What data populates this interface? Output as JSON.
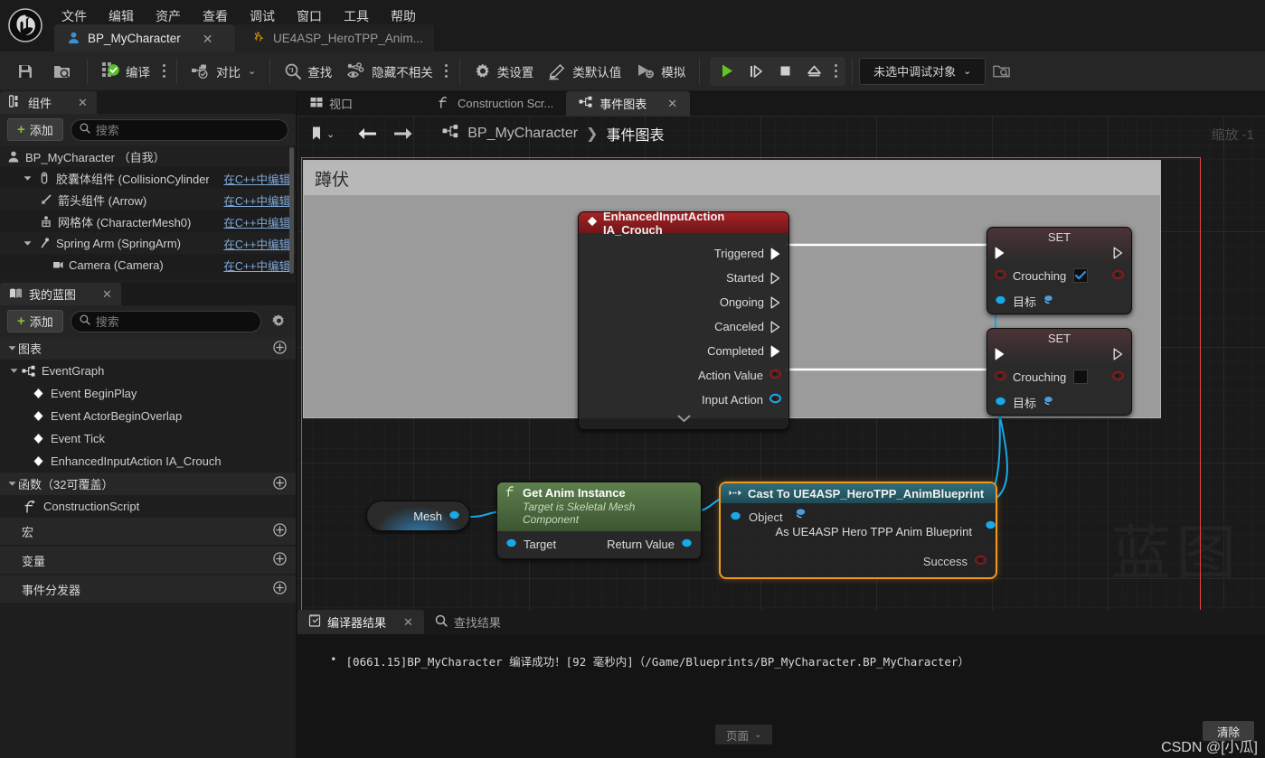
{
  "app": {
    "logo": "unreal-engine-logo",
    "menu": [
      "文件",
      "编辑",
      "资产",
      "查看",
      "调试",
      "窗口",
      "工具",
      "帮助"
    ]
  },
  "asset_tabs": [
    {
      "label": "BP_MyCharacter",
      "icon": "character-icon",
      "active": true,
      "closable": true
    },
    {
      "label": "UE4ASP_HeroTPP_Anim...",
      "icon": "anim-blueprint-icon",
      "active": false,
      "closable": false
    }
  ],
  "toolbar": {
    "save_label": "",
    "items": [
      {
        "name": "save",
        "label": ""
      },
      {
        "name": "browse",
        "label": ""
      },
      {
        "name": "compile",
        "label": "编译"
      },
      {
        "name": "diff",
        "label": "对比"
      },
      {
        "name": "find",
        "label": "查找"
      },
      {
        "name": "hide-unrelated",
        "label": "隐藏不相关"
      },
      {
        "name": "class-settings",
        "label": "类设置"
      },
      {
        "name": "class-defaults",
        "label": "类默认值"
      },
      {
        "name": "simulate",
        "label": "模拟"
      }
    ],
    "compile_label": "编译",
    "diff_label": "对比",
    "find_label": "查找",
    "hide_unrelated_label": "隐藏不相关",
    "class_settings_label": "类设置",
    "class_defaults_label": "类默认值",
    "simulate_label": "模拟",
    "debug_object": "未选中调试对象"
  },
  "components_panel": {
    "tab_label": "组件",
    "add_label": "添加",
    "search_placeholder": "搜索",
    "tree": [
      {
        "label": "BP_MyCharacter （自我）",
        "icon": "character-icon",
        "indent": 0,
        "expander": "none",
        "cpp": ""
      },
      {
        "label": "胶囊体组件 (CollisionCylinder)",
        "icon": "capsule-icon",
        "indent": 1,
        "expander": "down",
        "cpp": "在C++中编辑"
      },
      {
        "label": "箭头组件 (Arrow)",
        "icon": "arrow-icon",
        "indent": 2,
        "expander": "none",
        "cpp": "在C++中编辑"
      },
      {
        "label": "网格体 (CharacterMesh0)",
        "icon": "mesh-icon",
        "indent": 2,
        "expander": "none",
        "cpp": "在C++中编辑"
      },
      {
        "label": "Spring Arm (SpringArm)",
        "icon": "springarm-icon",
        "indent": 1,
        "expander": "down",
        "cpp": "在C++中编辑"
      },
      {
        "label": "Camera (Camera)",
        "icon": "camera-icon",
        "indent": 2,
        "expander": "none",
        "cpp": "在C++中编辑"
      }
    ]
  },
  "myblueprint_panel": {
    "tab_label": "我的蓝图",
    "add_label": "添加",
    "search_placeholder": "搜索",
    "sections": [
      {
        "type": "category",
        "label": "图表",
        "caret": "down",
        "plus": true
      },
      {
        "type": "item",
        "label": "EventGraph",
        "icon": "graph-icon",
        "indent": 1,
        "caret": "down"
      },
      {
        "type": "item",
        "label": "Event BeginPlay",
        "icon": "event-icon",
        "indent": 2
      },
      {
        "type": "item",
        "label": "Event ActorBeginOverlap",
        "icon": "event-icon",
        "indent": 2
      },
      {
        "type": "item",
        "label": "Event Tick",
        "icon": "event-icon",
        "indent": 2
      },
      {
        "type": "item",
        "label": "EnhancedInputAction IA_Crouch",
        "icon": "event-icon",
        "indent": 2
      },
      {
        "type": "category",
        "label": "函数（32可覆盖）",
        "caret": "down",
        "plus": true
      },
      {
        "type": "item",
        "label": "ConstructionScript",
        "icon": "function-icon",
        "indent": 1
      },
      {
        "type": "category",
        "label": "宏",
        "caret": "none",
        "plus": true
      },
      {
        "type": "category",
        "label": "变量",
        "caret": "none",
        "plus": true
      },
      {
        "type": "category",
        "label": "事件分发器",
        "caret": "none",
        "plus": true
      }
    ]
  },
  "graph": {
    "tabs": [
      {
        "label": "视口",
        "icon": "viewport-icon",
        "active": false,
        "closable": false
      },
      {
        "label": "Construction Scr...",
        "icon": "function-icon",
        "active": false,
        "closable": false
      },
      {
        "label": "事件图表",
        "icon": "graph-icon",
        "active": true,
        "closable": true
      }
    ],
    "breadcrumb": {
      "root": "BP_MyCharacter",
      "current": "事件图表"
    },
    "zoom_label": "缩放 -1",
    "watermark": "蓝图",
    "comment": {
      "title": "蹲伏"
    },
    "nodes": [
      {
        "id": "input-action",
        "title": "EnhancedInputAction IA_Crouch",
        "header_color": "#9b1f22",
        "pins": [
          {
            "label": "Triggered",
            "type": "exec",
            "connected": true
          },
          {
            "label": "Started",
            "type": "exec",
            "connected": false
          },
          {
            "label": "Ongoing",
            "type": "exec",
            "connected": false
          },
          {
            "label": "Canceled",
            "type": "exec",
            "connected": false
          },
          {
            "label": "Completed",
            "type": "exec",
            "connected": true
          },
          {
            "label": "Action Value",
            "type": "struct",
            "color": "#8f1717",
            "connected": false
          },
          {
            "label": "Input Action",
            "type": "object",
            "color": "#1fb0ee",
            "connected": false
          }
        ],
        "collapse_icon": "chevron-down-icon"
      },
      {
        "id": "set-crouching-true",
        "title": "SET",
        "header_color": "#6b2b2d",
        "variable_label": "Crouching",
        "checkbox_checked": true,
        "target_label": "目标"
      },
      {
        "id": "set-crouching-false",
        "title": "SET",
        "header_color": "#6b2b2d",
        "variable_label": "Crouching",
        "checkbox_checked": false,
        "target_label": "目标"
      },
      {
        "id": "mesh-variable",
        "title": "Mesh"
      },
      {
        "id": "get-anim-instance",
        "title": "Get Anim Instance",
        "subtitle": "Target is Skeletal Mesh Component",
        "header_color": "#4c6b3f",
        "input_label": "Target",
        "output_label": "Return Value"
      },
      {
        "id": "cast-node",
        "title": "Cast To UE4ASP_HeroTPP_AnimBlueprint",
        "header_color": "#2d6570",
        "input_label": "Object",
        "output_label": "As UE4ASP Hero TPP Anim Blueprint",
        "success_label": "Success",
        "selected": true
      }
    ]
  },
  "results_panel": {
    "tabs": [
      {
        "label": "编译器结果",
        "icon": "compiler-icon",
        "active": true,
        "closable": true
      },
      {
        "label": "查找结果",
        "icon": "search-icon",
        "active": false,
        "closable": false
      }
    ],
    "messages": [
      "[0661.15]BP_MyCharacter 编译成功！[92 毫秒内]（/Game/Blueprints/BP_MyCharacter.BP_MyCharacter）"
    ],
    "page_label": "页面",
    "clear_label": "清除"
  },
  "watermark_credit": "CSDN @[小瓜]"
}
